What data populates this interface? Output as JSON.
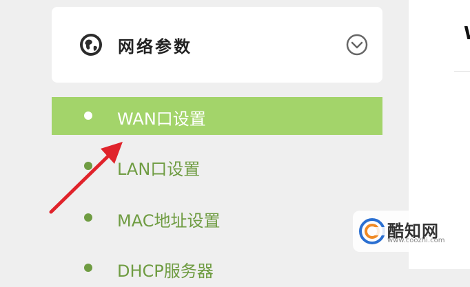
{
  "card": {
    "title": "网络参数",
    "globe_icon": "globe-icon",
    "chevron_icon": "chevron-down-circle-icon"
  },
  "menu": {
    "items": [
      {
        "label": "WAN口设置",
        "active": true
      },
      {
        "label": "LAN口设置",
        "active": false
      },
      {
        "label": "MAC地址设置",
        "active": false
      },
      {
        "label": "DHCP服务器",
        "active": false
      }
    ]
  },
  "right_panel": {
    "char": "W"
  },
  "watermark": {
    "name": "酷知网",
    "url": "www.coozhi.com"
  },
  "colors": {
    "accent": "#a3d46a",
    "menu_text": "#6f9c42",
    "background": "#efefef",
    "arrow": "#e0232b"
  }
}
